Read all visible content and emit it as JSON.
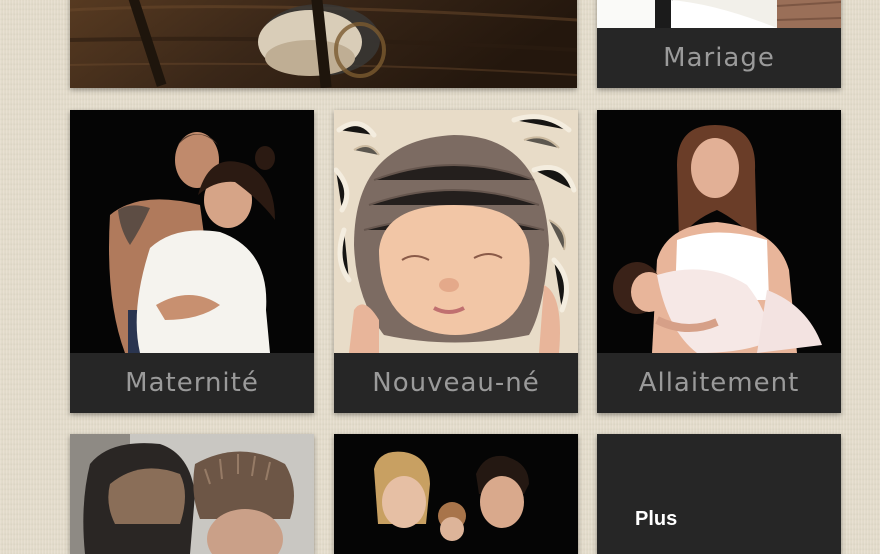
{
  "gallery": {
    "tiles": [
      {
        "id": "hourglass",
        "caption": ""
      },
      {
        "id": "mariage",
        "caption": "Mariage"
      },
      {
        "id": "maternite",
        "caption": "Maternité"
      },
      {
        "id": "nouveau-ne",
        "caption": "Nouveau-né"
      },
      {
        "id": "allaitement",
        "caption": "Allaitement"
      },
      {
        "id": "winter",
        "caption": ""
      },
      {
        "id": "famille",
        "caption": ""
      },
      {
        "id": "plus",
        "caption": "Plus"
      }
    ]
  },
  "colors": {
    "background": "#e4dccb",
    "tile": "#262626",
    "caption_text": "#9a9a9a"
  }
}
